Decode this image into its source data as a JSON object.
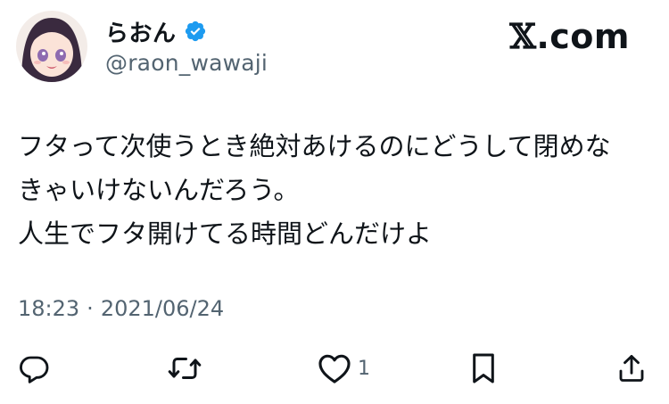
{
  "author": {
    "display_name": "らおん",
    "handle": "@raon_wawaji",
    "verified": true
  },
  "brand": {
    "x_glyph": "𝕏",
    "suffix": ".com"
  },
  "tweet": {
    "lines": [
      "フタって次使うとき絶対あけるのにどうして閉めな",
      "きゃいけないんだろう。",
      "人生でフタ開けてる時間どんだけよ"
    ]
  },
  "meta": {
    "time": "18:23",
    "separator": "·",
    "date": "2021/06/24"
  },
  "actions": {
    "like_count": "1",
    "icons": [
      "reply-icon",
      "retweet-icon",
      "like-icon",
      "bookmark-icon",
      "share-icon"
    ]
  },
  "colors": {
    "text": "#0f1419",
    "secondary": "#536471",
    "verified": "#1d9bf0"
  }
}
